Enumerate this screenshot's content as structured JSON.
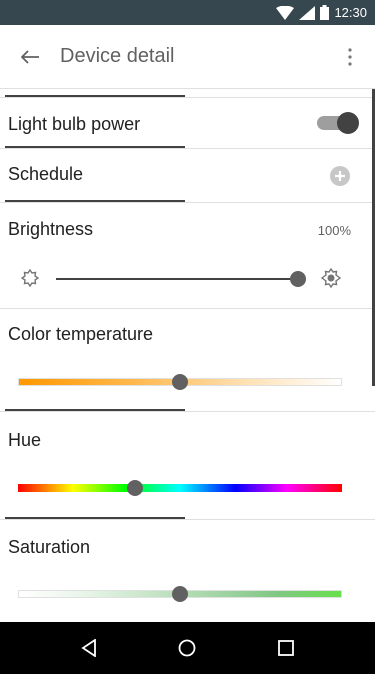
{
  "status_bar": {
    "time": "12:30",
    "icons": [
      "wifi-icon",
      "signal-icon",
      "battery-icon"
    ]
  },
  "app_bar": {
    "title": "Device detail",
    "back_icon": "back-arrow-icon",
    "more_icon": "more-vert-icon"
  },
  "settings": {
    "power": {
      "label": "Light bulb power",
      "enabled": true
    },
    "schedule": {
      "label": "Schedule",
      "add_icon": "add-circle-icon"
    },
    "brightness": {
      "label": "Brightness",
      "value": "100%",
      "level": 1.0,
      "min_icon": "brightness-low-icon",
      "max_icon": "brightness-high-icon"
    },
    "color_temperature": {
      "label": "Color temperature",
      "level": 0.5
    },
    "hue": {
      "label": "Hue",
      "level": 0.36
    },
    "saturation": {
      "label": "Saturation",
      "level": 0.5
    }
  },
  "nav_bar": {
    "items": [
      "back-triangle-icon",
      "home-circle-icon",
      "recents-square-icon"
    ]
  },
  "colors": {
    "status_bar": "#37474f",
    "accent_dark": "#424242",
    "nav_bar": "#000000"
  }
}
